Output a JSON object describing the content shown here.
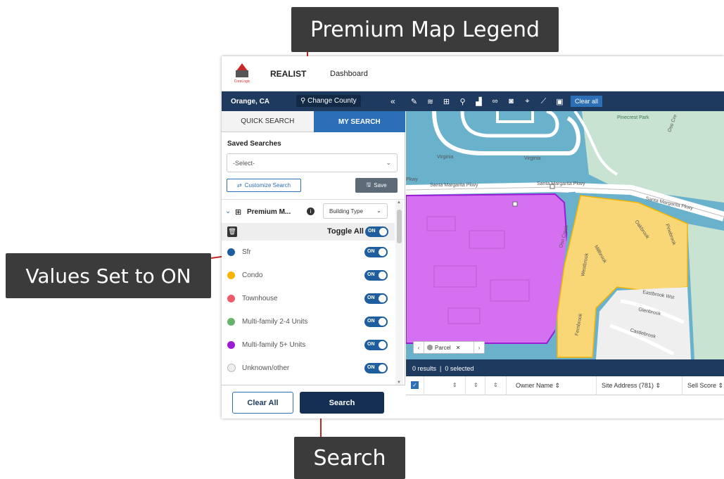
{
  "callouts": {
    "legend": "Premium Map Legend",
    "values_on": "Values Set to ON",
    "search": "Search"
  },
  "topbar": {
    "logo_text": "CoreLogic",
    "brand": "REALIST",
    "nav_dashboard": "Dashboard"
  },
  "locbar": {
    "location": "Orange, CA",
    "county_button": "Change County",
    "collapse_glyph": "«",
    "clear_all": "Clear all",
    "tool_icons": [
      "pencil-icon",
      "layers-icon",
      "grid-icon",
      "pin-icon",
      "chart-icon",
      "binoculars-icon",
      "car-icon",
      "map-pin-icon",
      "ruler-icon",
      "comment-icon"
    ]
  },
  "panel": {
    "tabs": {
      "quick": "QUICK SEARCH",
      "mine": "MY SEARCH"
    },
    "saved_searches_label": "Saved Searches",
    "select_value": "-Select-",
    "customize_button": "Customize Search",
    "save_button": "Save",
    "legend_title": "Premium M...",
    "legend_type": "Building Type",
    "toggle_all_label": "Toggle All",
    "toggle_on_text": "ON",
    "legend_items": [
      {
        "label": "Sfr",
        "color": "#1f5e9e",
        "on": true
      },
      {
        "label": "Condo",
        "color": "#f5b400",
        "on": true
      },
      {
        "label": "Townhouse",
        "color": "#ef5b6b",
        "on": true
      },
      {
        "label": "Multi-family 2-4 Units",
        "color": "#68b36b",
        "on": true
      },
      {
        "label": "Multi-family 5+ Units",
        "color": "#9b1bd6",
        "on": true
      },
      {
        "label": "Unknown/other",
        "color": "#bbbbbb",
        "on": true
      }
    ],
    "clear_all_button": "Clear All",
    "search_button": "Search"
  },
  "map": {
    "labels": {
      "pinecrest": "Pinecrest Park",
      "oso_creek_top": "Oso Cre",
      "virginia_1": "Virginia",
      "virginia_2": "Virginia",
      "santa_margarita_1": "Santa Margarita Pkwy",
      "santa_margarita_2": "Santa Margarita Pkwy",
      "santa_margarita_3": "Santa Margarita Pkwy",
      "pkwy": "Pkwy",
      "oso_creek_mid": "Oso Creek",
      "eastbrook": "Eastbrook Wst",
      "glenbrook": "Glenbrook",
      "castlebrook": "Castlebrook",
      "millbrook": "Millbrook",
      "fernbrook": "Fernbrook",
      "westbrook": "Westbrook",
      "oakbrook": "Oakbrook",
      "pinebrook": "Pinebrook"
    },
    "parcel_label": "Parcel"
  },
  "results": {
    "count_text": "0 results  |  0 selected",
    "columns": [
      "Owner Name ⇕",
      "Site Address (781) ⇕",
      "Sell Score ⇕"
    ]
  }
}
